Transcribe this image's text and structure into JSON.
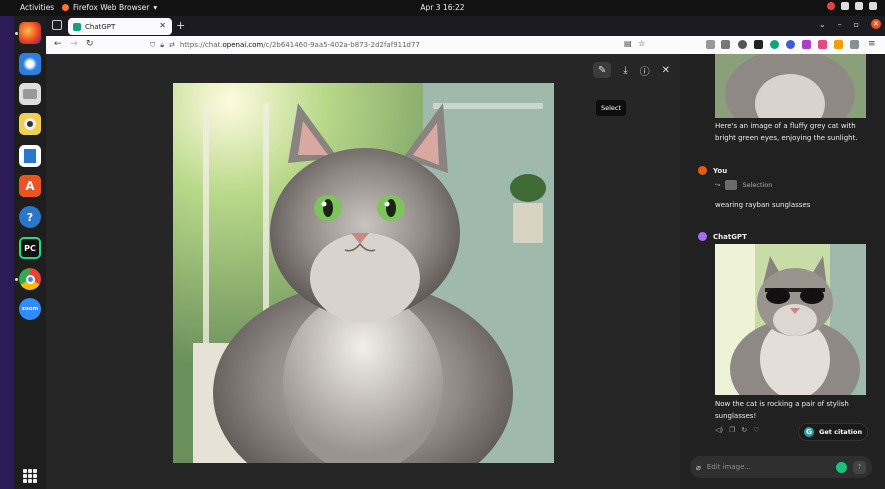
{
  "topbar": {
    "activities": "Activities",
    "app": "Firefox Web Browser",
    "clock": "Apr 3  16:22"
  },
  "browser": {
    "tab_title": "ChatGPT",
    "url_scheme": "https://chat.",
    "url_host": "openai.com",
    "url_path": "/c/2b641460-9aa5-402a-b873-2d2faf911d77"
  },
  "viewer": {
    "tooltip": "Select"
  },
  "chat": {
    "msg1": "Here's an image of a fluffy grey cat with bright green eyes, enjoying the sunlight.",
    "user_name": "You",
    "selection_label": "Selection",
    "user_msg": "wearing rayban sunglasses",
    "bot_name": "ChatGPT",
    "msg2": "Now the cat is rocking a pair of stylish sunglasses!",
    "citation_button": "Get citation",
    "input_placeholder": "Edit image..."
  },
  "dock": {
    "zoom_label": "zoom",
    "apps": [
      "firefox",
      "thunderbird",
      "files",
      "rhythmbox",
      "writer",
      "app-center",
      "help",
      "pycharm",
      "chrome",
      "zoom"
    ]
  }
}
